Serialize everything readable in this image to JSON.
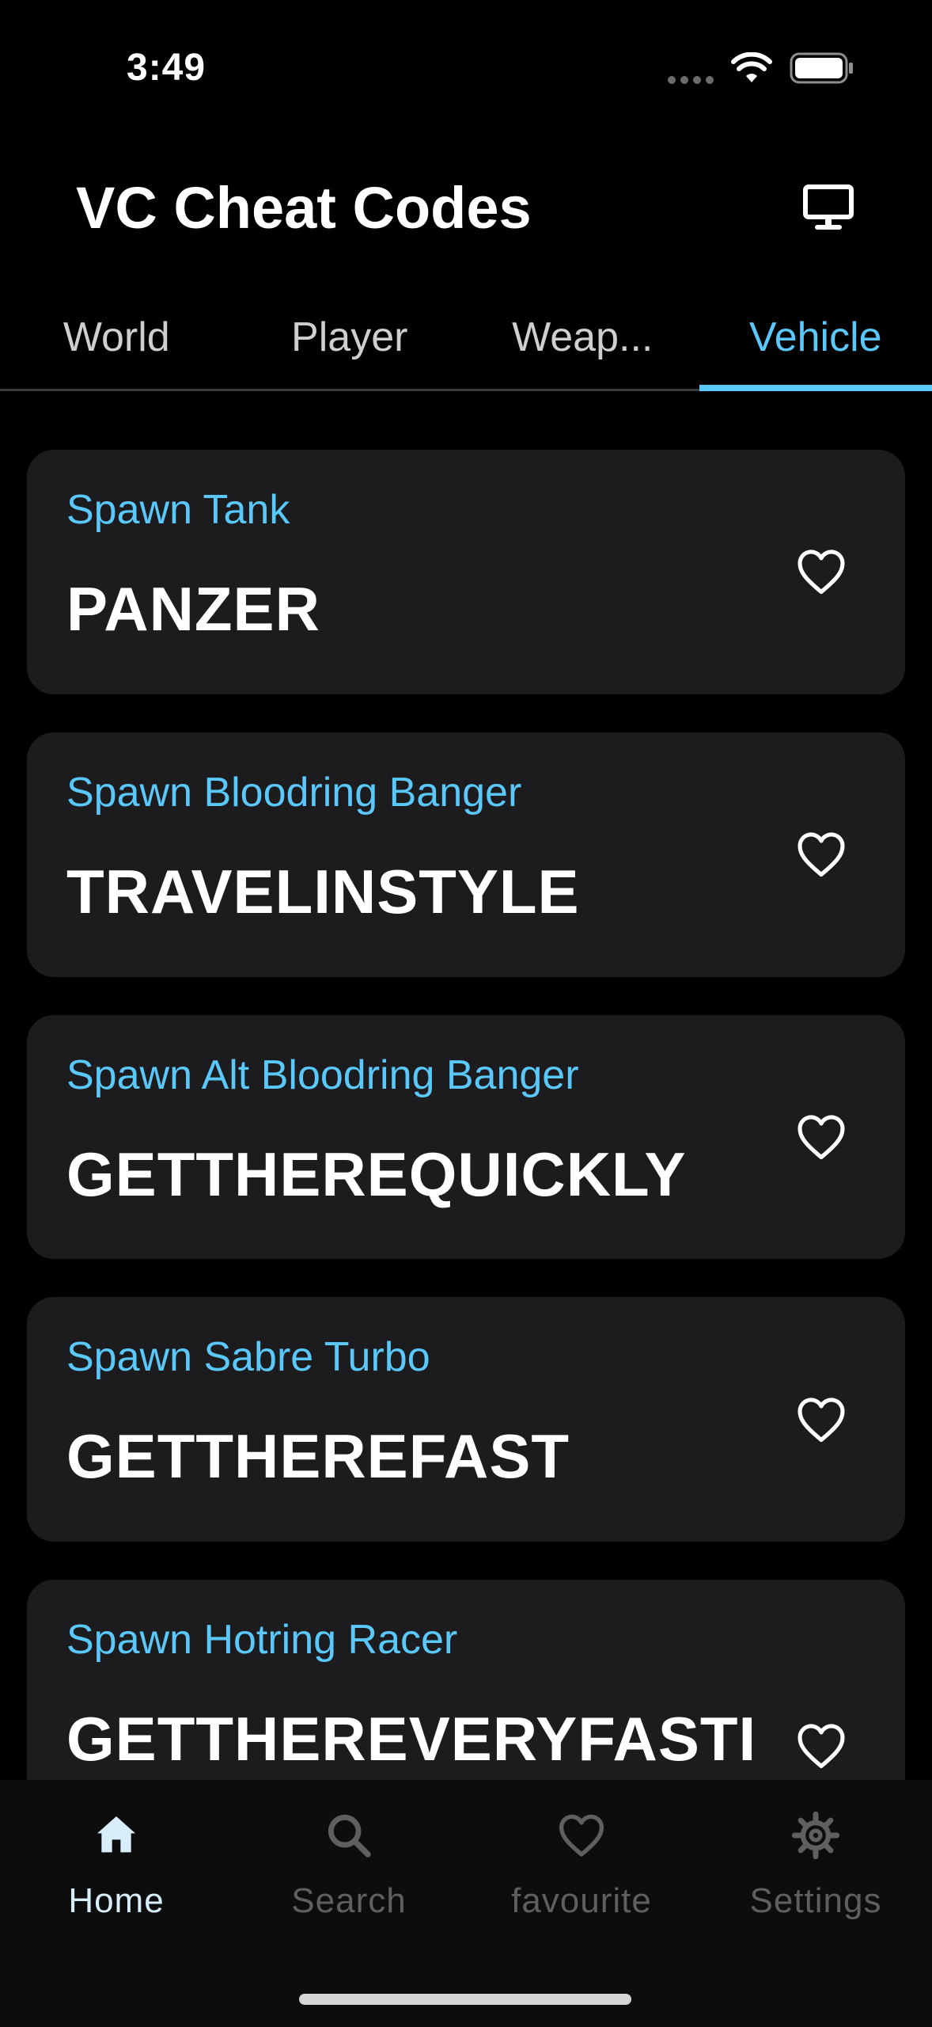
{
  "status_bar": {
    "time": "3:49"
  },
  "header": {
    "title": "VC Cheat Codes"
  },
  "tabs": [
    {
      "label": "World",
      "active": false
    },
    {
      "label": "Player",
      "active": false
    },
    {
      "label": "Weap...",
      "active": false
    },
    {
      "label": "Vehicle",
      "active": true
    }
  ],
  "cheats": [
    {
      "label": "Spawn Tank",
      "code": "PANZER"
    },
    {
      "label": "Spawn Bloodring Banger",
      "code": "TRAVELINSTYLE"
    },
    {
      "label": "Spawn Alt Bloodring Banger",
      "code": "GETTHEREQUICKLY"
    },
    {
      "label": "Spawn Sabre Turbo",
      "code": "GETTHEREFAST"
    },
    {
      "label": "Spawn Hotring Racer",
      "code": "GETTHEREVERYFASTINDEED"
    }
  ],
  "bottom_nav": [
    {
      "label": "Home",
      "icon": "home-icon",
      "active": true
    },
    {
      "label": "Search",
      "icon": "search-icon",
      "active": false
    },
    {
      "label": "favourite",
      "icon": "heart-icon",
      "active": false
    },
    {
      "label": "Settings",
      "icon": "gear-icon",
      "active": false
    }
  ],
  "colors": {
    "accent": "#5ac8fa",
    "card": "#1c1c1e",
    "background": "#000000"
  }
}
